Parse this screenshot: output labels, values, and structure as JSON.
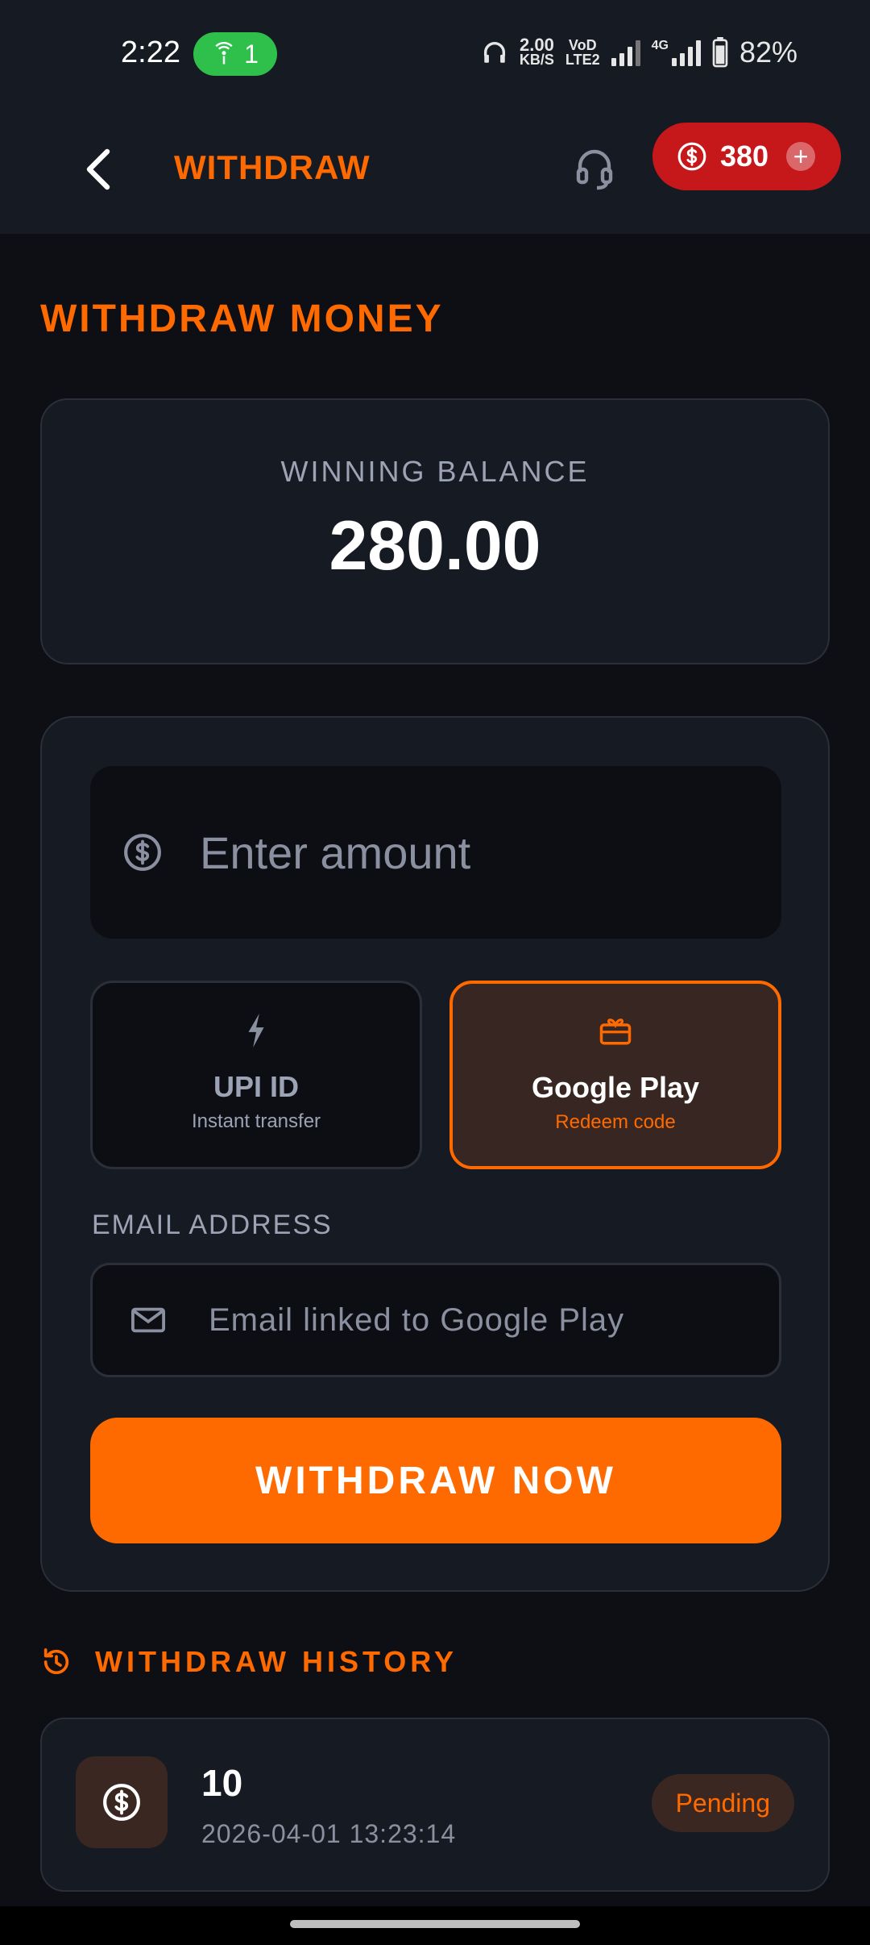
{
  "status_bar": {
    "time": "2:22",
    "hotspot_count": "1",
    "net_speed_value": "2.00",
    "net_speed_unit": "KB/S",
    "volte_top": "VoD",
    "volte_bottom": "LTE2",
    "network_type": "4G",
    "battery": "82%"
  },
  "app_bar": {
    "title": "WITHDRAW",
    "coins": "380",
    "add_symbol": "+"
  },
  "page": {
    "section_title": "WITHDRAW MONEY"
  },
  "balance": {
    "label": "WINNING BALANCE",
    "value": "280.00"
  },
  "form": {
    "amount_placeholder": "Enter amount",
    "methods": [
      {
        "title": "UPI ID",
        "subtitle": "Instant transfer",
        "selected": false
      },
      {
        "title": "Google Play",
        "subtitle": "Redeem code",
        "selected": true
      }
    ],
    "email_label": "EMAIL ADDRESS",
    "email_placeholder": "Email linked to Google Play",
    "submit_label": "WITHDRAW NOW"
  },
  "history": {
    "title": "WITHDRAW HISTORY",
    "items": [
      {
        "amount": "10",
        "date": "2026-04-01 13:23:14",
        "status": "Pending"
      }
    ]
  },
  "colors": {
    "accent": "#ff6a00",
    "coin_pill": "#c6181b",
    "background": "#0d0f14",
    "card": "#161a22",
    "hotspot_pill": "#2ec04a"
  }
}
